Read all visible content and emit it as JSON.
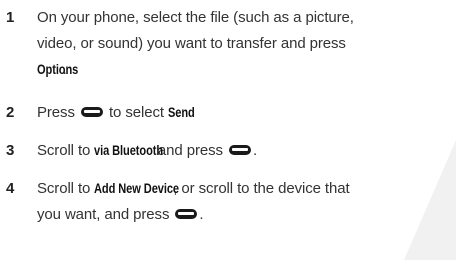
{
  "steps": [
    {
      "number": "1",
      "line1": "On your phone, select the file (such as a picture,",
      "line2a": "video, or sound) you want to transfer and press",
      "term": "Options",
      "after": "."
    },
    {
      "number": "2",
      "before": "Press ",
      "middle": " to select ",
      "term": "Send",
      "after": "."
    },
    {
      "number": "3",
      "before": "Scroll to ",
      "term": "via Bluetooth",
      "middle": " and press ",
      "after": "."
    },
    {
      "number": "4",
      "before": "Scroll to ",
      "term": "Add New Device",
      "line1_rest": ", or scroll to the device that",
      "line2": "you want, and press ",
      "after": "."
    }
  ],
  "icons": [
    "center-select-key-icon"
  ],
  "colors": {
    "text": "#333333",
    "background": "#ffffff"
  }
}
